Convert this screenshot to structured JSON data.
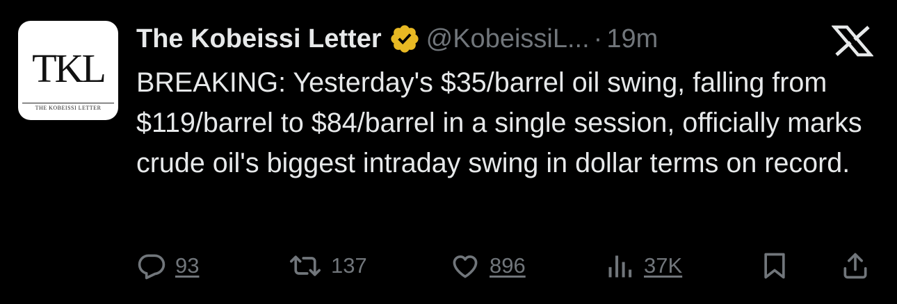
{
  "colors": {
    "background": "#000000",
    "text": "#e7e9ea",
    "secondary": "#71767b",
    "verified_gold": "#e8b923"
  },
  "avatar": {
    "monogram": "TKL",
    "subtitle": "THE KOBEISSI LETTER"
  },
  "author": {
    "display_name": "The Kobeissi Letter",
    "verified_icon": "verified-badge-icon",
    "handle": "@KobeissiL...",
    "separator": "·",
    "time": "19m"
  },
  "platform_icon": "x-logo-icon",
  "tweet": {
    "text": "BREAKING: Yesterday's $35/barrel oil swing, falling from $119/barrel to $84/barrel in a single session, officially marks crude oil's biggest intraday swing in dollar terms on record."
  },
  "actions": {
    "reply": {
      "icon": "reply-icon",
      "count": "93"
    },
    "retweet": {
      "icon": "retweet-icon",
      "count": "137"
    },
    "like": {
      "icon": "heart-icon",
      "count": "896"
    },
    "views": {
      "icon": "views-icon",
      "count": "37K"
    },
    "bookmark": {
      "icon": "bookmark-icon"
    },
    "share": {
      "icon": "share-icon"
    }
  }
}
